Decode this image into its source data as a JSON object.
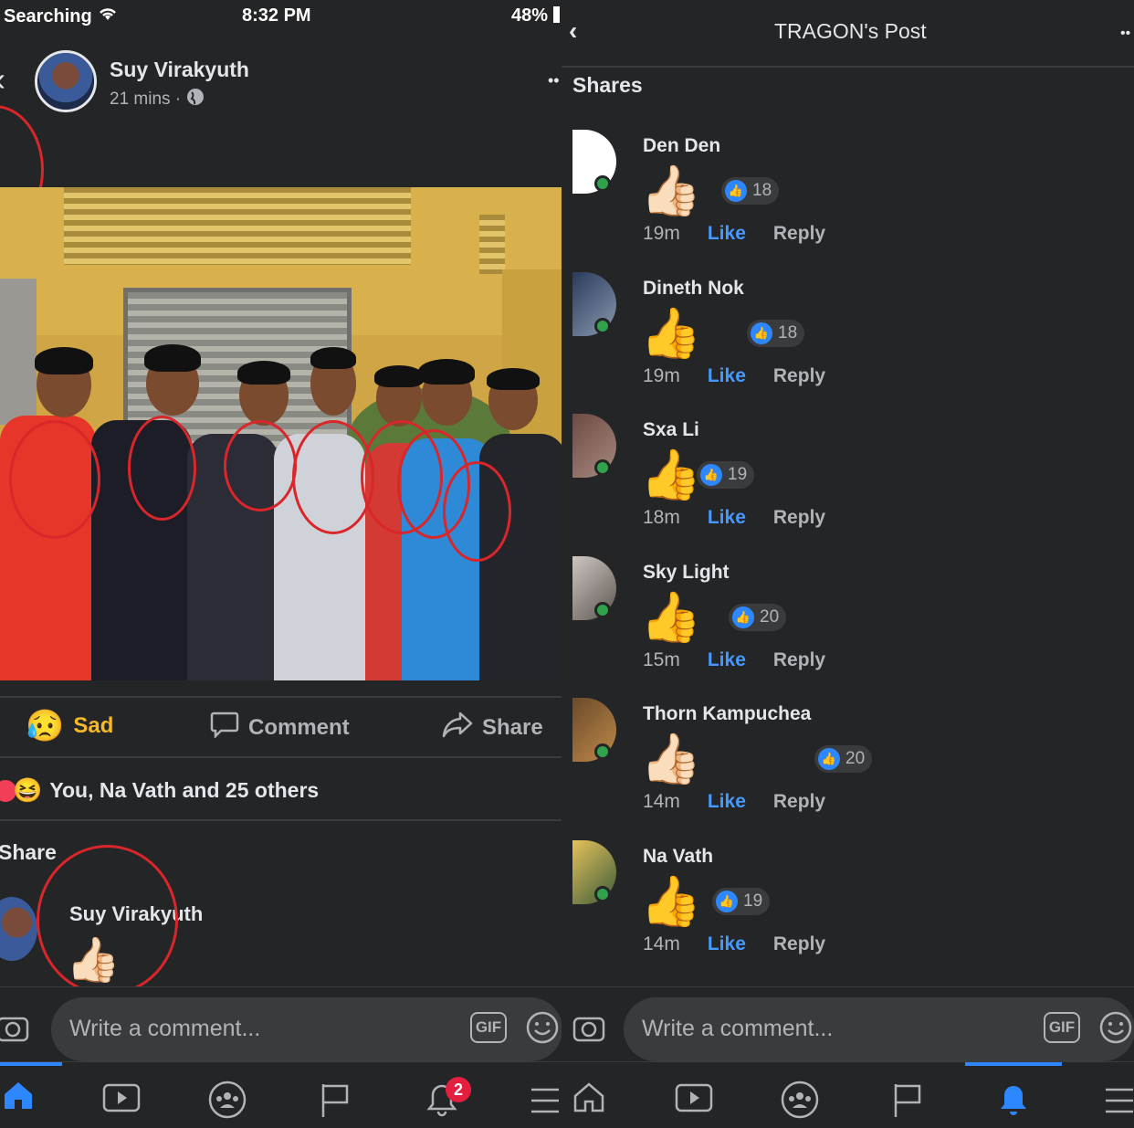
{
  "left": {
    "status": {
      "carrier": "Searching",
      "time": "8:32 PM",
      "battery": "48%"
    },
    "post": {
      "author": "Suy Virakyuth",
      "time": "21 mins ·"
    },
    "actions": {
      "reaction": "Sad",
      "comment": "Comment",
      "share": "Share"
    },
    "reactions_summary": "You, Na Vath and 25 others",
    "share_section": {
      "title": "Share",
      "sharer_name": "Suy Virakyuth"
    },
    "comment_input": {
      "placeholder": "Write a comment...",
      "gif": "GIF"
    },
    "tabbar": {
      "notification_count": "2"
    }
  },
  "right": {
    "header": {
      "title": "TRAGON's Post"
    },
    "section_title": "Shares",
    "comments": [
      {
        "name": "Den Den",
        "likes": "18",
        "time": "19m",
        "like": "Like",
        "reply": "Reply"
      },
      {
        "name": "Dineth Nok",
        "likes": "18",
        "time": "19m",
        "like": "Like",
        "reply": "Reply"
      },
      {
        "name": "Sxa Li",
        "likes": "19",
        "time": "18m",
        "like": "Like",
        "reply": "Reply"
      },
      {
        "name": "Sky Light",
        "likes": "20",
        "time": "15m",
        "like": "Like",
        "reply": "Reply"
      },
      {
        "name": "Thorn Kampuchea",
        "likes": "20",
        "time": "14m",
        "like": "Like",
        "reply": "Reply"
      },
      {
        "name": "Na Vath",
        "likes": "19",
        "time": "14m",
        "like": "Like",
        "reply": "Reply"
      }
    ],
    "comment_input": {
      "placeholder": "Write a comment...",
      "gif": "GIF"
    }
  },
  "colors": {
    "background": "#242526",
    "like_blue": "#4599ff",
    "online_green": "#31a24c",
    "annotation_red": "#d9262b",
    "badge_red": "#e41e3f"
  },
  "icons": [
    "wifi-icon",
    "globe-icon",
    "sad-emoji-icon",
    "comment-icon",
    "share-arrow-icon",
    "camera-icon",
    "smiley-icon",
    "home-icon",
    "video-icon",
    "groups-icon",
    "flag-icon",
    "bell-icon",
    "menu-icon",
    "thumbs-up-icon",
    "like-badge-icon"
  ]
}
